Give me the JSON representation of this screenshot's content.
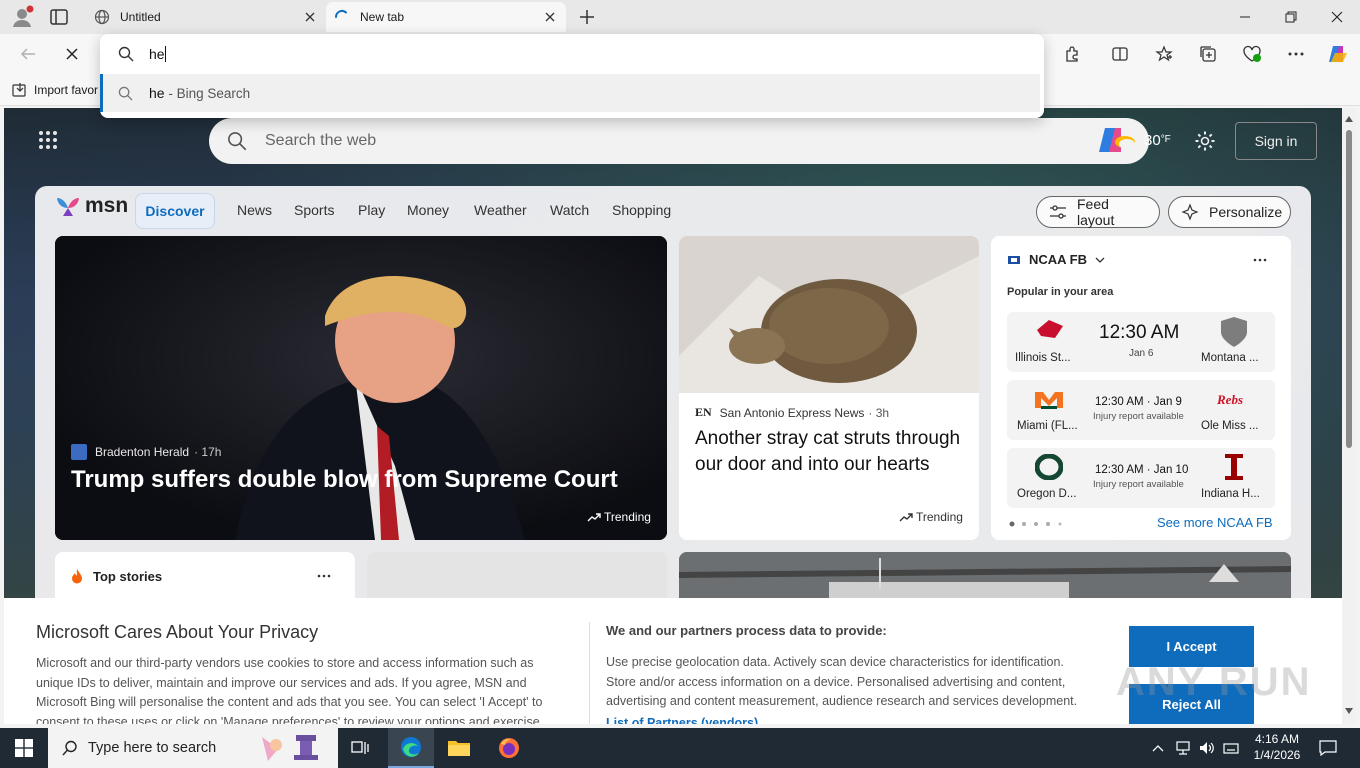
{
  "browser": {
    "tabs": [
      {
        "label": "Untitled",
        "state": "inactive"
      },
      {
        "label": "New tab",
        "state": "active"
      }
    ],
    "favorites_bar": {
      "import_label": "Import favor"
    },
    "omnibox": {
      "value": "he",
      "suggestion_query": "he",
      "suggestion_source": " - Bing Search"
    }
  },
  "msn": {
    "search_placeholder": "Search the web",
    "weather_temp": "30",
    "weather_unit": "°F",
    "sign_in": "Sign in",
    "logo_text": "msn",
    "nav": [
      "Discover",
      "News",
      "Sports",
      "Play",
      "Money",
      "Weather",
      "Watch",
      "Shopping"
    ],
    "active_nav": "Discover",
    "feed_layout": "Feed layout",
    "personalize": "Personalize",
    "hero": {
      "source": "Bradenton Herald",
      "age": "· 17h",
      "title": "Trump suffers double blow from Supreme Court",
      "badge": "Trending"
    },
    "story2": {
      "source_abbr": "EN",
      "source": "San Antonio Express News",
      "age": "· 3h",
      "title": "Another stray cat struts through our door and into our hearts",
      "badge": "Trending"
    },
    "sports": {
      "league": "NCAA FB",
      "subtitle": "Popular in your area",
      "games": [
        {
          "home": "Illinois St...",
          "away": "Montana ...",
          "time": "12:30 AM",
          "date": "Jan 6",
          "note": ""
        },
        {
          "home": "Miami (FL...",
          "away": "Ole Miss ...",
          "time": "12:30 AM · Jan 9",
          "date": "",
          "note": "Injury report available"
        },
        {
          "home": "Oregon D...",
          "away": "Indiana H...",
          "time": "12:30 AM · Jan 10",
          "date": "",
          "note": "Injury report available"
        }
      ],
      "see_more": "See more NCAA FB"
    },
    "top_stories": "Top stories"
  },
  "privacy": {
    "title": "Microsoft Cares About Your Privacy",
    "body": "Microsoft and our third-party vendors use cookies to store and access information such as unique IDs to deliver, maintain and improve our services and ads. If you agree, MSN and Microsoft Bing will personalise the content and ads that you see. You can select 'I Accept' to consent to these uses or click on 'Manage preferences' to review your options and exercise",
    "right_title": "We and our partners process data to provide:",
    "right_body": "Use precise geolocation data. Actively scan device characteristics for identification. Store and/or access information on a device. Personalised advertising and content, advertising and content measurement, audience research and services development.",
    "partners_link": "List of Partners (vendors)",
    "accept": "I Accept",
    "reject": "Reject All",
    "watermark": "ANY RUN"
  },
  "taskbar": {
    "search_placeholder": "Type here to search",
    "time": "4:16 AM",
    "date": "1/4/2026"
  },
  "colors": {
    "accent": "#0f6cbd",
    "taskbar": "#1f2a35"
  }
}
